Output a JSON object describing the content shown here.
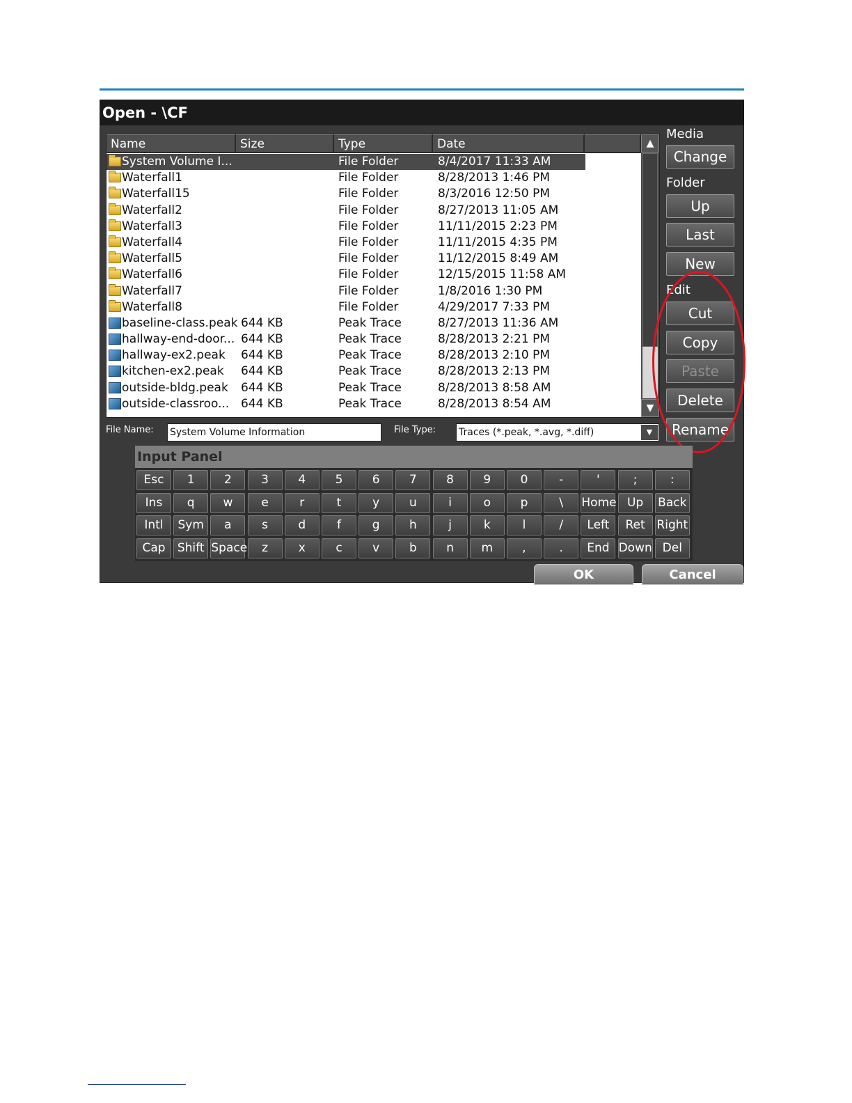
{
  "dialog": {
    "title": "Open - \\CF"
  },
  "columns": [
    "Name",
    "Size",
    "Type",
    "Date",
    ""
  ],
  "files": [
    {
      "icon": "folder-icon",
      "name": "System Volume I...",
      "size": "",
      "type": "File Folder",
      "date": "8/4/2017 11:33 AM",
      "selected": true
    },
    {
      "icon": "folder-icon",
      "name": "Waterfall1",
      "size": "",
      "type": "File Folder",
      "date": "8/28/2013 1:46 PM"
    },
    {
      "icon": "folder-icon",
      "name": "Waterfall15",
      "size": "",
      "type": "File Folder",
      "date": "8/3/2016 12:50 PM"
    },
    {
      "icon": "folder-icon",
      "name": "Waterfall2",
      "size": "",
      "type": "File Folder",
      "date": "8/27/2013 11:05 AM"
    },
    {
      "icon": "folder-icon",
      "name": "Waterfall3",
      "size": "",
      "type": "File Folder",
      "date": "11/11/2015 2:23 PM"
    },
    {
      "icon": "folder-icon",
      "name": "Waterfall4",
      "size": "",
      "type": "File Folder",
      "date": "11/11/2015 4:35 PM"
    },
    {
      "icon": "folder-icon",
      "name": "Waterfall5",
      "size": "",
      "type": "File Folder",
      "date": "11/12/2015 8:49 AM"
    },
    {
      "icon": "folder-icon",
      "name": "Waterfall6",
      "size": "",
      "type": "File Folder",
      "date": "12/15/2015 11:58 AM"
    },
    {
      "icon": "folder-icon",
      "name": "Waterfall7",
      "size": "",
      "type": "File Folder",
      "date": "1/8/2016 1:30 PM"
    },
    {
      "icon": "folder-icon",
      "name": "Waterfall8",
      "size": "",
      "type": "File Folder",
      "date": "4/29/2017 7:33 PM"
    },
    {
      "icon": "trace-file-icon",
      "name": "baseline-class.peak",
      "size": "644 KB",
      "type": "Peak Trace",
      "date": "8/27/2013 11:36 AM"
    },
    {
      "icon": "trace-file-icon",
      "name": "hallway-end-door...",
      "size": "644 KB",
      "type": "Peak Trace",
      "date": "8/28/2013 2:21 PM"
    },
    {
      "icon": "trace-file-icon",
      "name": "hallway-ex2.peak",
      "size": "644 KB",
      "type": "Peak Trace",
      "date": "8/28/2013 2:10 PM"
    },
    {
      "icon": "trace-file-icon",
      "name": "kitchen-ex2.peak",
      "size": "644 KB",
      "type": "Peak Trace",
      "date": "8/28/2013 2:13 PM"
    },
    {
      "icon": "trace-file-icon",
      "name": "outside-bldg.peak",
      "size": "644 KB",
      "type": "Peak Trace",
      "date": "8/28/2013 8:58 AM"
    },
    {
      "icon": "trace-file-icon",
      "name": "outside-classroo...",
      "size": "644 KB",
      "type": "Peak Trace",
      "date": "8/28/2013 8:54 AM"
    }
  ],
  "scrollbar": {
    "up_glyph": "▲",
    "down_glyph": "▼"
  },
  "side": {
    "media_label": "Media",
    "change": "Change",
    "folder_label": "Folder",
    "up": "Up",
    "last": "Last",
    "new": "New",
    "edit_label": "Edit",
    "cut": "Cut",
    "copy": "Copy",
    "paste": "Paste",
    "delete": "Delete",
    "rename": "Rename"
  },
  "file_name": {
    "label": "File Name:",
    "value": "System Volume Information"
  },
  "file_type": {
    "label": "File Type:",
    "value": "Traces (*.peak, *.avg, *.diff)",
    "arrow": "▼"
  },
  "input_panel": {
    "title": "Input Panel",
    "rows": [
      [
        "Esc",
        "1",
        "2",
        "3",
        "4",
        "5",
        "6",
        "7",
        "8",
        "9",
        "0",
        "-",
        "'",
        ";",
        ":"
      ],
      [
        "Ins",
        "q",
        "w",
        "e",
        "r",
        "t",
        "y",
        "u",
        "i",
        "o",
        "p",
        "\\",
        "Home",
        "Up",
        "Back"
      ],
      [
        "Intl",
        "Sym",
        "a",
        "s",
        "d",
        "f",
        "g",
        "h",
        "j",
        "k",
        "l",
        "/",
        "Left",
        "Ret",
        "Right"
      ],
      [
        "Cap",
        "Shift",
        "Space",
        "z",
        "x",
        "c",
        "v",
        "b",
        "n",
        "m",
        ",",
        ".",
        "End",
        "Down",
        "Del"
      ]
    ]
  },
  "footer": {
    "ok": "OK",
    "cancel": "Cancel"
  },
  "colors": {
    "accent_rule": "#1f7fc0",
    "highlight": "#e0141e",
    "dialog_bg": "#3a3a3a"
  }
}
